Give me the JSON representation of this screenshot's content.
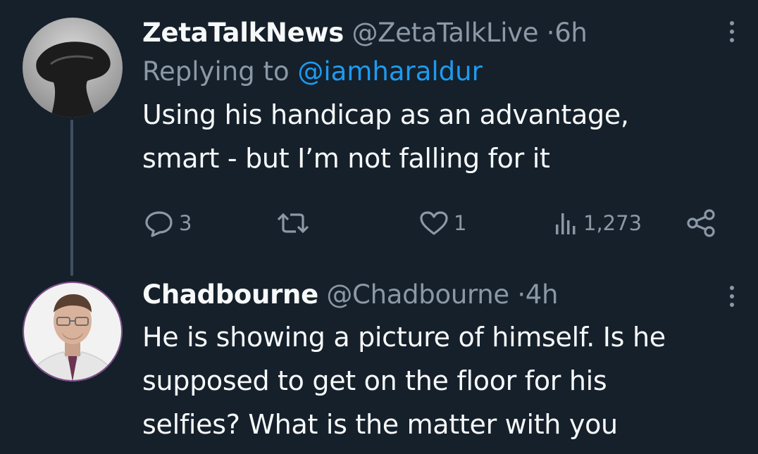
{
  "tweets": [
    {
      "display_name": "ZetaTalkNews",
      "handle": "@ZetaTalkLive",
      "separator": "·",
      "time": "6h",
      "replying_prefix": "Replying to",
      "replying_to": "@iamharaldur",
      "text_line1": "Using his handicap as an advantage,",
      "text_line2": "smart - but I’m not falling for it",
      "stats": {
        "replies": "3",
        "retweets": "",
        "likes": "1",
        "views": "1,273"
      },
      "avatar_icon": "alien-silhouette-avatar"
    },
    {
      "display_name": "Chadbourne",
      "handle": "@Chadbourne",
      "separator": "·",
      "time": "4h",
      "text_line1": "He is showing a picture of himself. Is he",
      "text_line2": "supposed to get on the floor for his",
      "text_line3": "selfies? What is the matter with you",
      "avatar_icon": "man-portrait-avatar"
    }
  ],
  "icons": {
    "reply": "reply-icon",
    "retweet": "retweet-icon",
    "like": "heart-icon",
    "views": "views-icon",
    "share": "share-icon",
    "more": "more-icon"
  },
  "colors": {
    "background": "#15202b",
    "primary_text": "#f7f9f9",
    "secondary_text": "#8b98a5",
    "link": "#1d9bf0",
    "thread_line": "#3e4f62"
  }
}
